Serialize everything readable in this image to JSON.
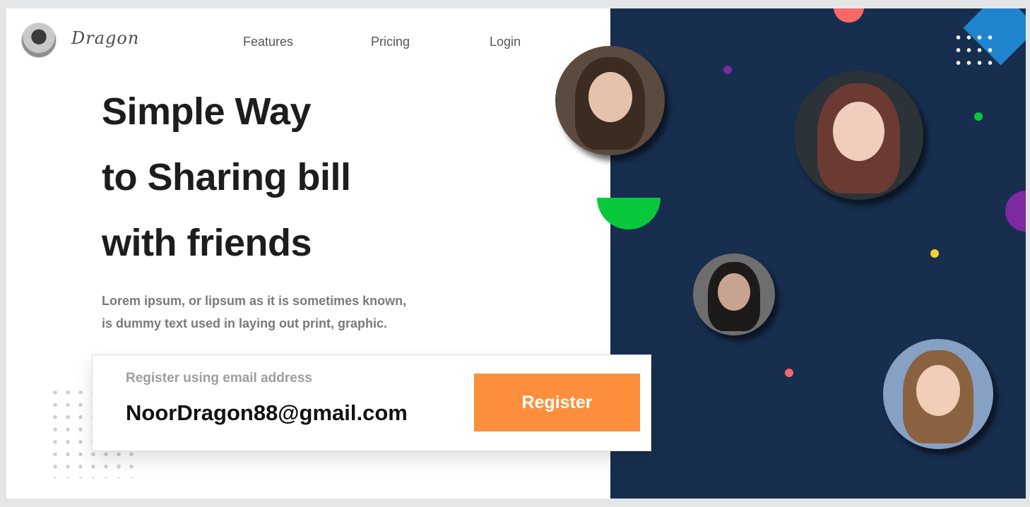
{
  "brand": {
    "name": "Dragon"
  },
  "nav": {
    "items": [
      "Features",
      "Pricing",
      "Login"
    ]
  },
  "hero": {
    "lines": [
      "Simple Way",
      "to Sharing bill",
      "with friends"
    ],
    "subtitle_lines": [
      "Lorem ipsum, or lipsum as it is sometimes known,",
      "is dummy text used in laying out print, graphic."
    ]
  },
  "register": {
    "label": "Register using email address",
    "email_value": "NoorDragon88@gmail.com",
    "button_label": "Register"
  },
  "colors": {
    "accent": "#fd8f3c",
    "panel": "#172e4f",
    "green": "#07c93b",
    "purple": "#7d29a0",
    "coral": "#f86868",
    "blue": "#1f84ce",
    "yellow": "#f5d02c"
  },
  "avatars": [
    {
      "icon": "woman-portrait-brown-curly-hair"
    },
    {
      "icon": "woman-portrait-long-auburn-hair"
    },
    {
      "icon": "woman-portrait-glasses-dark-hair"
    },
    {
      "icon": "woman-portrait-smiling-glasses"
    }
  ]
}
